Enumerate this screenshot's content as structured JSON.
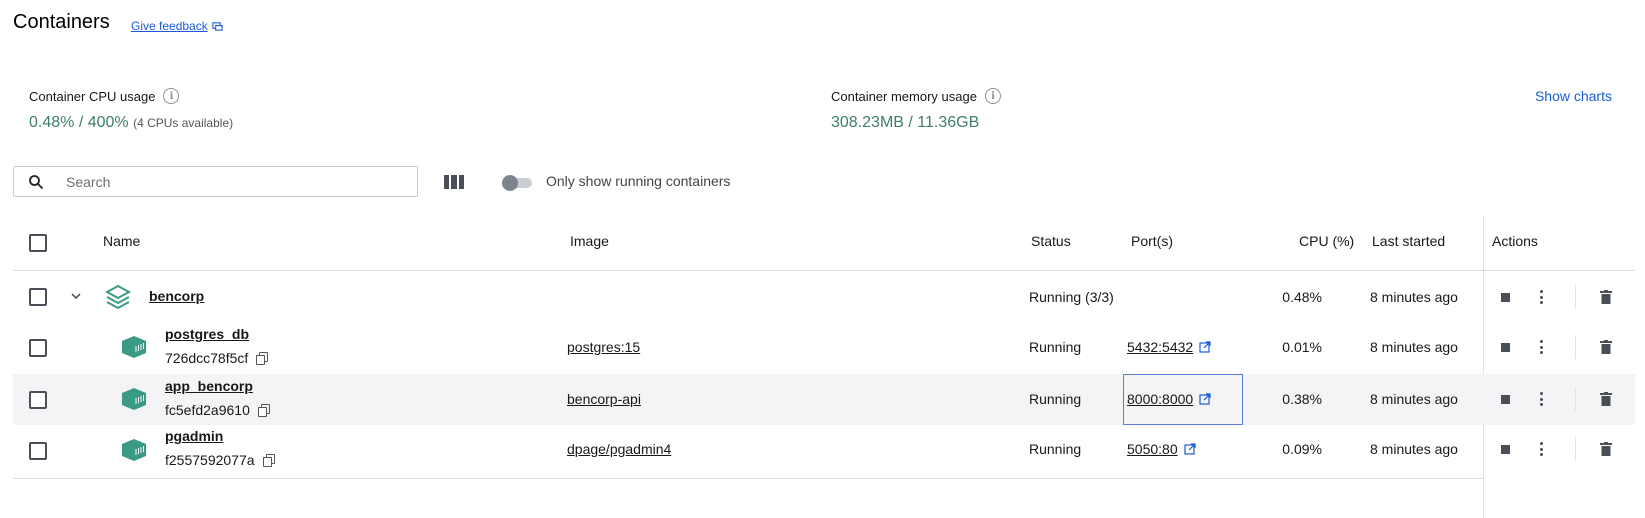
{
  "header": {
    "title": "Containers",
    "feedback_label": "Give feedback"
  },
  "stats": {
    "cpu_label": "Container CPU usage",
    "cpu_value": "0.48% / 400%",
    "cpu_sub": "(4 CPUs available)",
    "mem_label": "Container memory usage",
    "mem_value": "308.23MB / 11.36GB",
    "show_charts": "Show charts"
  },
  "toolbar": {
    "search_placeholder": "Search",
    "toggle_label": "Only show running containers",
    "toggle_on": false
  },
  "table": {
    "columns": {
      "name": "Name",
      "image": "Image",
      "status": "Status",
      "ports": "Port(s)",
      "cpu": "CPU (%)",
      "last_started": "Last started",
      "actions": "Actions"
    },
    "group": {
      "name": "bencorp",
      "status": "Running (3/3)",
      "cpu": "0.48%",
      "last_started": "8 minutes ago"
    },
    "rows": [
      {
        "name": "postgres_db",
        "id": "726dcc78f5cf",
        "image": "postgres:15",
        "status": "Running",
        "port": "5432:5432",
        "cpu": "0.01%",
        "last_started": "8 minutes ago"
      },
      {
        "name": "app_bencorp",
        "id": "fc5efd2a9610",
        "image": "bencorp-api",
        "status": "Running",
        "port": "8000:8000",
        "cpu": "0.38%",
        "last_started": "8 minutes ago"
      },
      {
        "name": "pgadmin",
        "id": "f2557592077a",
        "image": "dpage/pgadmin4",
        "status": "Running",
        "port": "5050:80",
        "cpu": "0.09%",
        "last_started": "8 minutes ago"
      }
    ]
  },
  "colors": {
    "accent_link": "#1a5bd6",
    "stat_green": "#3f7d6e",
    "container_icon": "#3b9a86"
  }
}
